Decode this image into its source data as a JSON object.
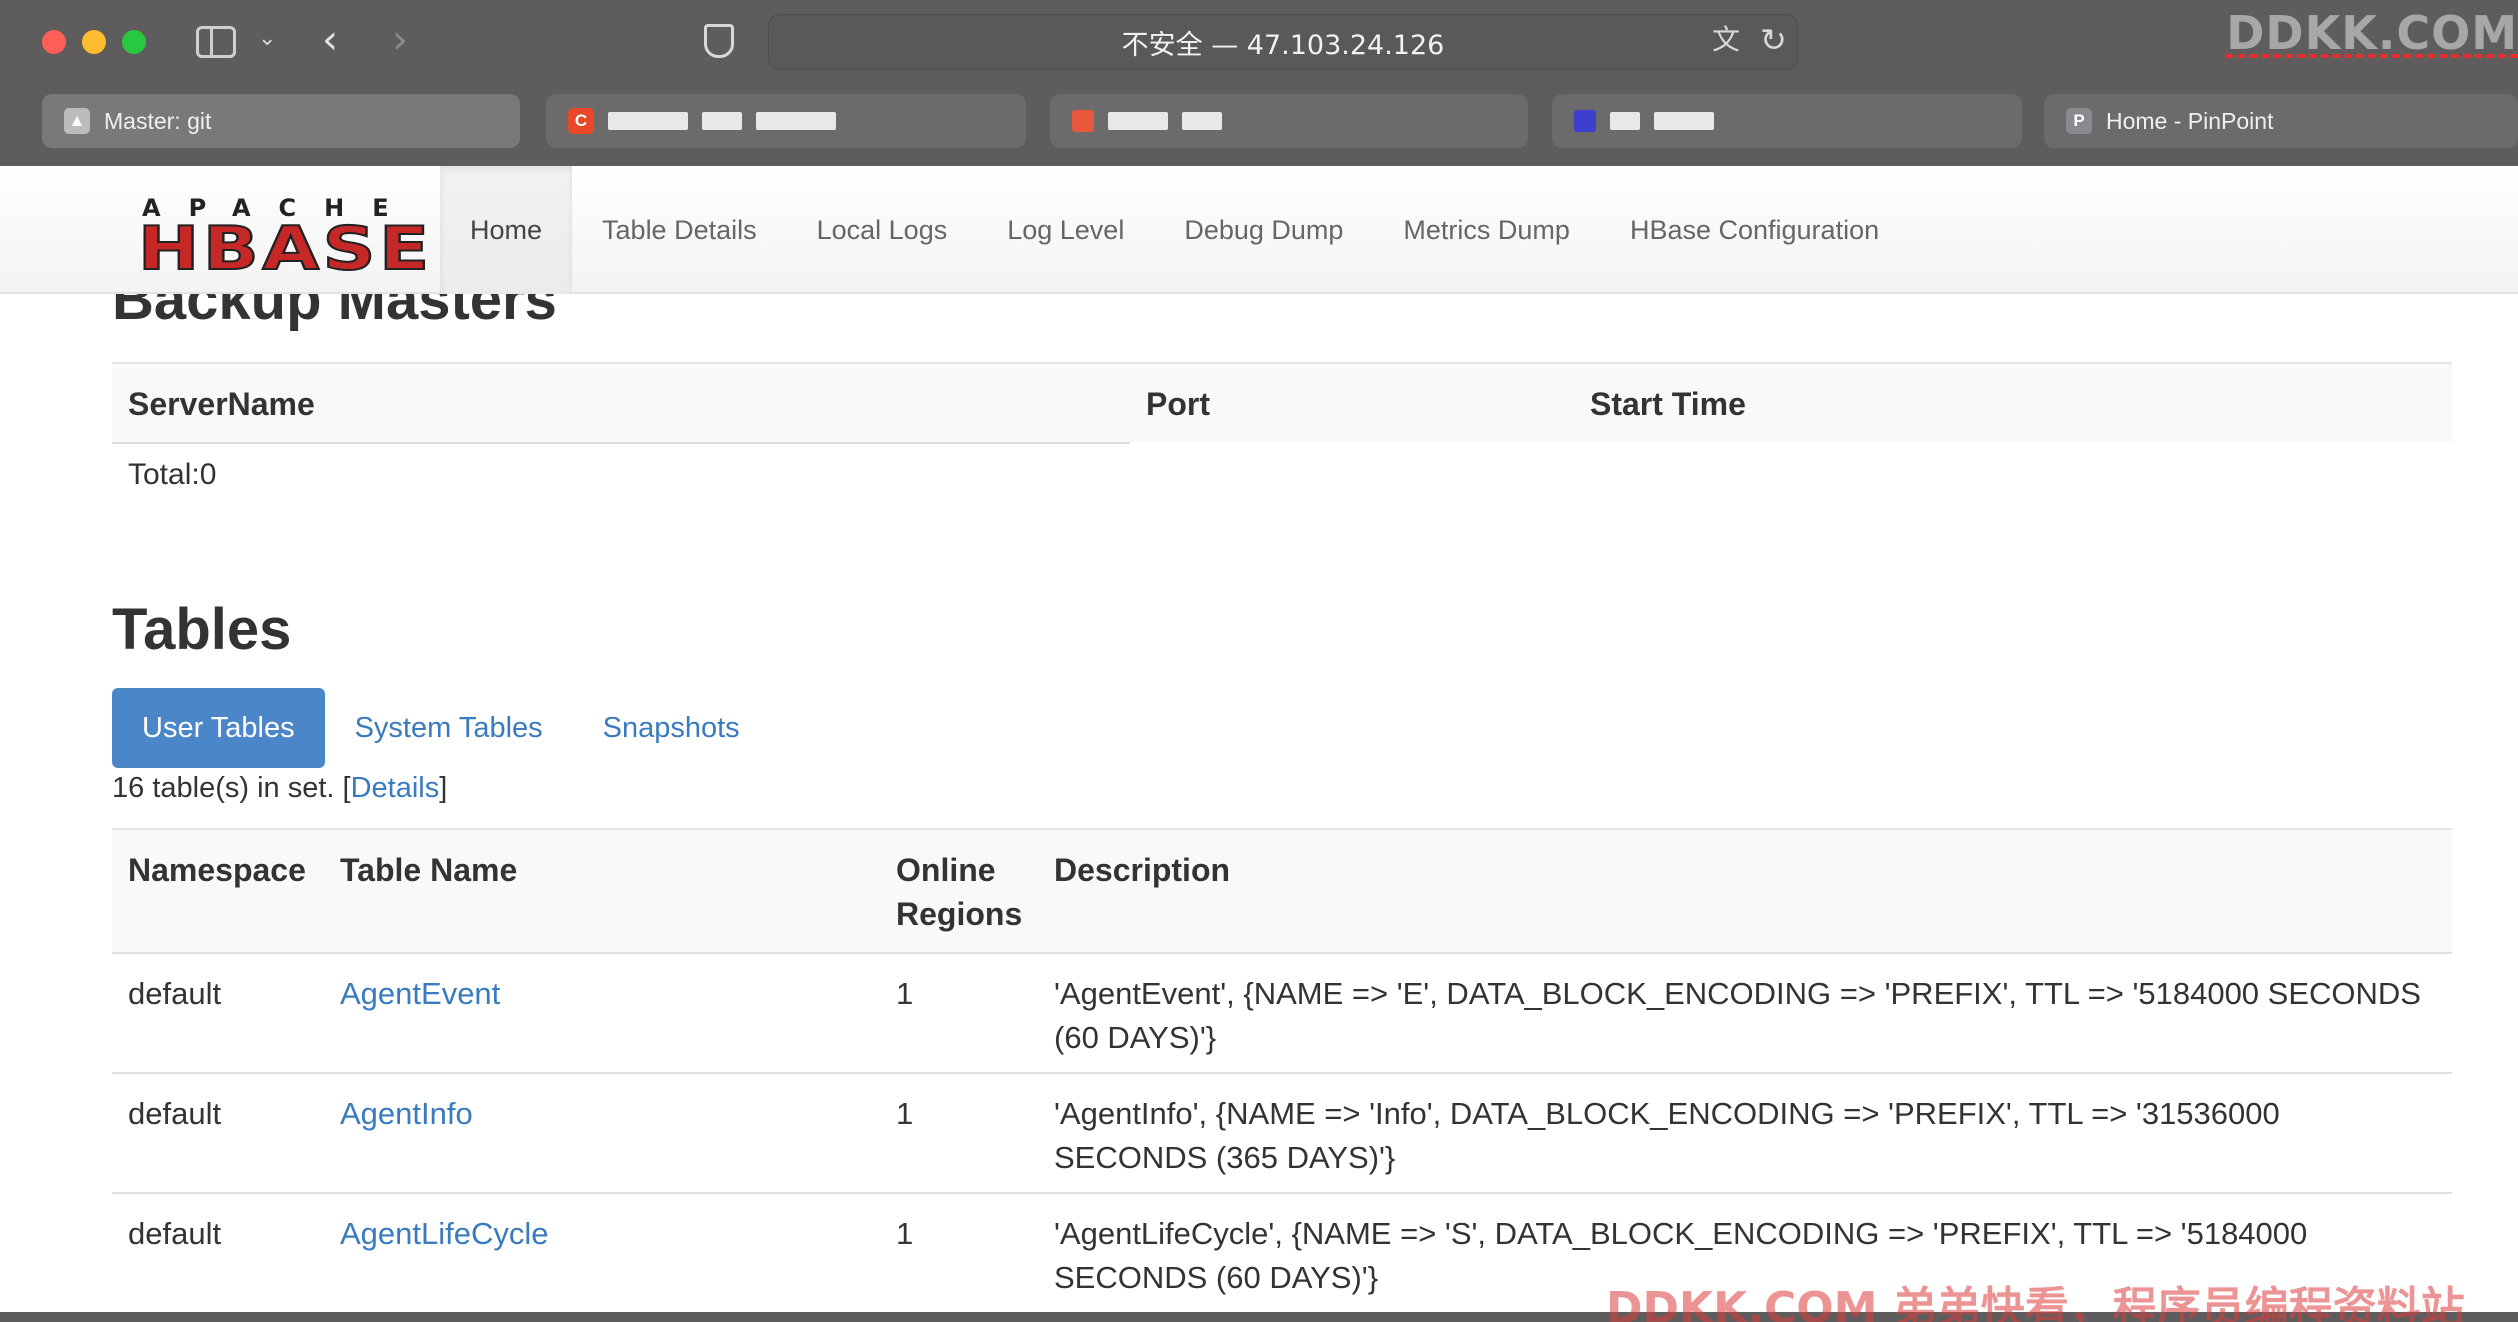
{
  "browser": {
    "address": "不安全 — 47.103.24.126",
    "tabs": [
      {
        "label": "Master: git",
        "favicon": "image-icon",
        "color": "#9e9c9d",
        "active": true
      },
      {
        "label": "",
        "favicon": "c-icon",
        "color": "#e8472a",
        "active": false
      },
      {
        "label": "",
        "favicon": "square-icon",
        "color": "#e8583a",
        "active": false
      },
      {
        "label": "",
        "favicon": "square-icon",
        "color": "#3f3fcf",
        "active": false
      },
      {
        "label": "Home - PinPoint",
        "favicon": "P",
        "color": "#8b8990",
        "active": false
      }
    ],
    "watermark": "DDKK.COM"
  },
  "hbase": {
    "logo_top": "APACHE",
    "logo_main": "HBASE",
    "nav": [
      {
        "label": "Home",
        "active": true
      },
      {
        "label": "Table Details"
      },
      {
        "label": "Local Logs"
      },
      {
        "label": "Log Level"
      },
      {
        "label": "Debug Dump"
      },
      {
        "label": "Metrics Dump"
      },
      {
        "label": "HBase Configuration"
      }
    ]
  },
  "backup_masters": {
    "title": "Backup Masters",
    "columns": [
      "ServerName",
      "Port",
      "Start Time"
    ],
    "total": "Total:0"
  },
  "tables": {
    "title": "Tables",
    "tabs": [
      "User Tables",
      "System Tables",
      "Snapshots"
    ],
    "count_prefix": "16 table(s) in set. [",
    "count_link": "Details",
    "count_suffix": "]",
    "columns": [
      "Namespace",
      "Table Name",
      "Online Regions",
      "Description"
    ],
    "rows": [
      {
        "namespace": "default",
        "name": "AgentEvent",
        "regions": "1",
        "description": "'AgentEvent', {NAME => 'E', DATA_BLOCK_ENCODING => 'PREFIX', TTL => '5184000 SECONDS (60 DAYS)'}"
      },
      {
        "namespace": "default",
        "name": "AgentInfo",
        "regions": "1",
        "description": "'AgentInfo', {NAME => 'Info', DATA_BLOCK_ENCODING => 'PREFIX', TTL => '31536000 SECONDS (365 DAYS)'}"
      },
      {
        "namespace": "default",
        "name": "AgentLifeCycle",
        "regions": "1",
        "description": "'AgentLifeCycle', {NAME => 'S', DATA_BLOCK_ENCODING => 'PREFIX', TTL => '5184000 SECONDS (60 DAYS)'}"
      }
    ]
  },
  "footer_watermark": "DDKK.COM 弟弟快看，程序员编程资料站"
}
